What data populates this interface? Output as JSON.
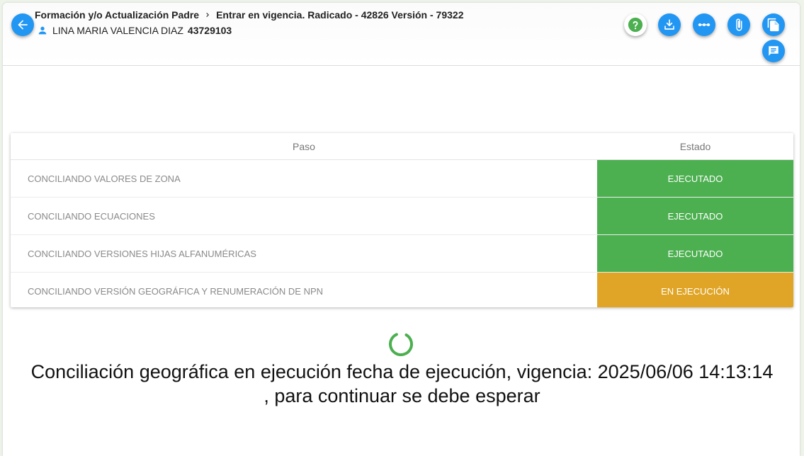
{
  "header": {
    "breadcrumb": [
      "Formación y/o Actualización Padre",
      "Entrar en vigencia. Radicado - 42826 Versión - 79322"
    ],
    "user_name": "LINA MARIA VALENCIA DIAZ",
    "user_id": "43729103"
  },
  "toolbar": {
    "icons": [
      "help-icon",
      "download-icon",
      "more-horizontal-icon",
      "attachment-icon",
      "copy-document-icon",
      "comments-icon"
    ]
  },
  "table": {
    "columns": [
      "Paso",
      "Estado"
    ],
    "rows": [
      {
        "step": "CONCILIANDO VALORES DE ZONA",
        "status": "EJECUTADO",
        "status_color": "#4caf50"
      },
      {
        "step": "CONCILIANDO ECUACIONES",
        "status": "EJECUTADO",
        "status_color": "#4caf50"
      },
      {
        "step": "CONCILIANDO VERSIONES HIJAS ALFANUMÉRICAS",
        "status": "EJECUTADO",
        "status_color": "#4caf50"
      },
      {
        "step": "CONCILIANDO VERSIÓN GEOGRÁFICA Y RENUMERACIÓN DE NPN",
        "status": "EN EJECUCIÓN",
        "status_color": "#e0a526"
      }
    ]
  },
  "message": {
    "line1": "Conciliación geográfica en ejecución fecha de ejecución, vigencia: 2025/06/06 14:13:14",
    "line2": ", para continuar se debe esperar"
  },
  "colors": {
    "primary": "#2196f3",
    "success": "#4caf50",
    "warning": "#e0a526",
    "help": "#4caf50",
    "spinner": "#4caf50"
  }
}
